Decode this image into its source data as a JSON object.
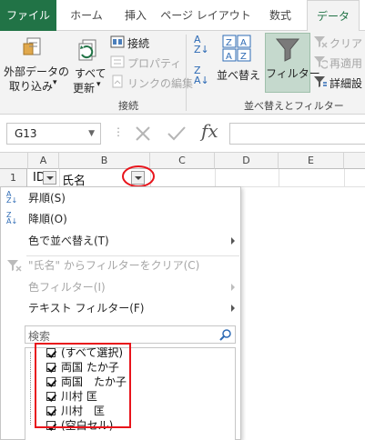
{
  "ribbon_tabs": {
    "file": "ファイル",
    "home": "ホーム",
    "insert": "挿入",
    "page_layout": "ページ レイアウト",
    "formulas": "数式",
    "data": "データ"
  },
  "ribbon": {
    "external_data_line1": "外部データの",
    "external_data_line2": "取り込み",
    "refresh_all_line1": "すべて",
    "refresh_all_line2": "更新",
    "connections": "接続",
    "properties": "プロパティ",
    "edit_links": "リンクの編集",
    "group_connections": "接続",
    "sort": "並べ替え",
    "filter": "フィルター",
    "clear": "クリア",
    "reapply": "再適用",
    "advanced": "詳細設",
    "group_sort_filter": "並べ替えとフィルター"
  },
  "formula_bar": {
    "name_box": "G13",
    "fx": "fx"
  },
  "sheet": {
    "columns": [
      "A",
      "B",
      "C",
      "D",
      "E"
    ],
    "row1_label": "1",
    "a1": "ID",
    "b1": "氏名"
  },
  "filter_menu": {
    "sort_asc": "昇順(S)",
    "sort_desc": "降順(O)",
    "sort_by_color": "色で並べ替え(T)",
    "clear_filter": "\"氏名\" からフィルターをクリア(C)",
    "color_filter": "色フィルター(I)",
    "text_filter": "テキスト フィルター(F)",
    "search_placeholder": "検索",
    "items": [
      "(すべて選択)",
      "両国 たか子",
      "両国　たか子",
      "川村 匡",
      "川村　匡",
      "(空白セル)"
    ]
  },
  "colors": {
    "excel_green": "#217346",
    "highlight_red": "#e8141b",
    "filter_button_active": "#c5d9cd"
  }
}
